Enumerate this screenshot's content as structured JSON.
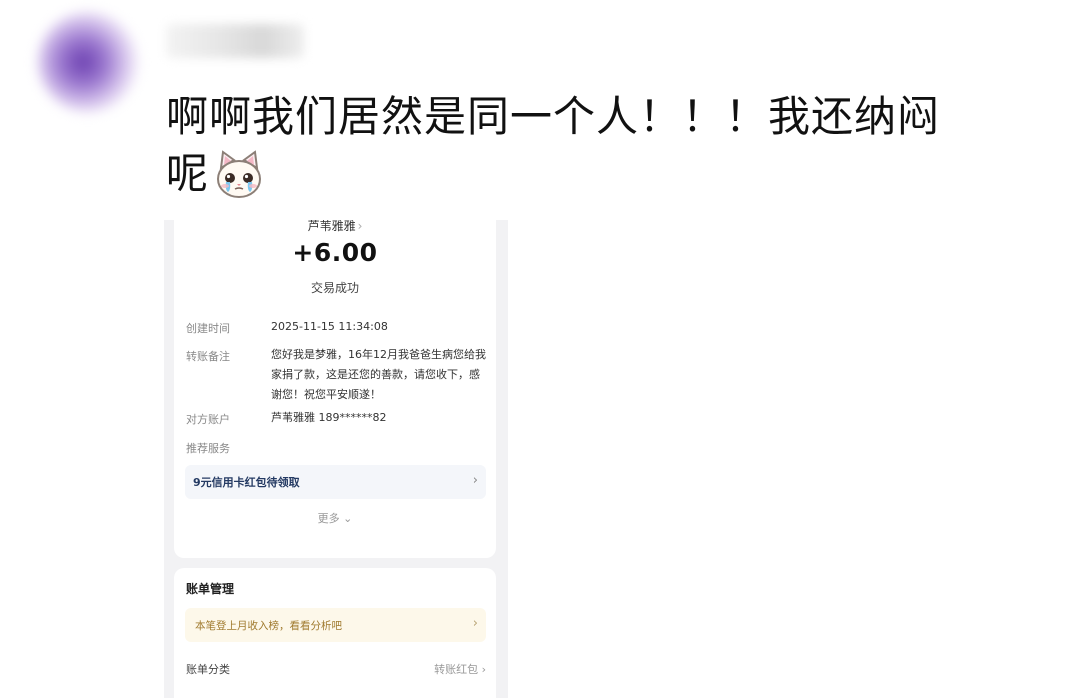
{
  "post": {
    "author_name": "用户",
    "text_line1": "啊啊我们居然是同一个人！！！我还纳闷",
    "text_line2": "呢",
    "emoji": "crying-cat-face"
  },
  "receipt": {
    "payer_name": "芦苇雅雅",
    "payer_chevron": "›",
    "amount": "+6.00",
    "status": "交易成功",
    "rows": [
      {
        "label": "创建时间",
        "value": "2025-11-15 11:34:08"
      },
      {
        "label": "转账备注",
        "value": "您好我是梦雅，16年12月我爸爸生病您给我家捐了款，这是还您的善款，请您收下，感谢您！祝您平安顺遂！"
      },
      {
        "label": "对方账户",
        "value": "芦苇雅雅 189******82"
      },
      {
        "label": "推荐服务",
        "value": ""
      }
    ],
    "promo": {
      "label": "9元信用卡红包待领取",
      "chevron": "›"
    },
    "more_label": "更多",
    "more_chevron": "⌄"
  },
  "bill": {
    "title": "账单管理",
    "tip": {
      "label": "本笔登上月收入榜，看看分析吧",
      "chevron": "›"
    },
    "category_label": "账单分类",
    "category_value": "转账红包",
    "category_chevron": "›"
  },
  "colors": {
    "promo_text": "#243a63",
    "tip_bg": "#fdf8ea",
    "tip_text": "#a07a2e"
  }
}
